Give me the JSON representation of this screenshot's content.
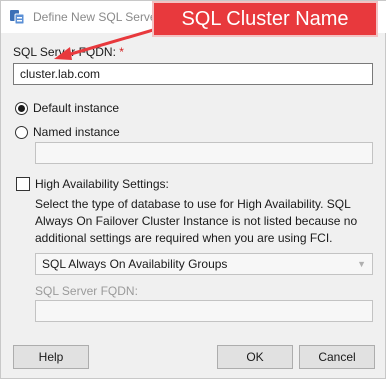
{
  "window": {
    "title": "Define New SQL Server"
  },
  "annotation": {
    "callout_text": "SQL Cluster Name",
    "callout_color": "#e8393d"
  },
  "fqdn": {
    "label": "SQL Server FQDN:",
    "required_mark": "*",
    "value": "cluster.lab.com"
  },
  "instance": {
    "default_label": "Default instance",
    "default_selected": true,
    "named_label": "Named instance",
    "named_value": ""
  },
  "ha": {
    "checkbox_label": "High Availability Settings:",
    "checked": false,
    "description": "Select the type of database to use for High Availability. SQL Always On Failover Cluster Instance is not listed because no additional settings are required when you are using FCI.",
    "select_value": "SQL Always On Availability Groups",
    "fqdn_label": "SQL Server FQDN:",
    "fqdn_value": ""
  },
  "buttons": {
    "help": "Help",
    "ok": "OK",
    "cancel": "Cancel"
  },
  "icons": {
    "app": "sql-server-icon",
    "arrow": "pointer-arrow-icon",
    "chevron": "chevron-down-icon"
  }
}
